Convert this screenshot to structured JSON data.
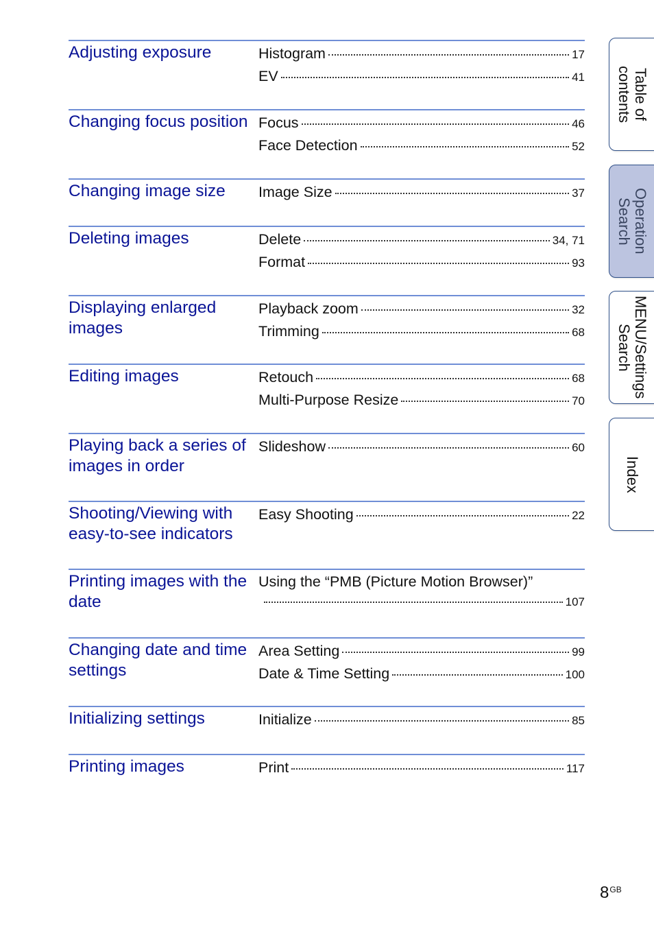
{
  "sections": [
    {
      "topic": "Adjusting exposure",
      "entries": [
        {
          "label": "Histogram",
          "page": "17"
        },
        {
          "label": "EV",
          "page": "41"
        }
      ]
    },
    {
      "topic": "Changing focus position",
      "entries": [
        {
          "label": "Focus",
          "page": "46"
        },
        {
          "label": "Face Detection",
          "page": "52"
        }
      ]
    },
    {
      "topic": "Changing image size",
      "entries": [
        {
          "label": "Image Size",
          "page": "37"
        }
      ]
    },
    {
      "topic": "Deleting images",
      "entries": [
        {
          "label": "Delete",
          "page": "34, 71"
        },
        {
          "label": "Format",
          "page": "93"
        }
      ]
    },
    {
      "topic": "Displaying enlarged images",
      "entries": [
        {
          "label": "Playback zoom",
          "page": "32"
        },
        {
          "label": "Trimming",
          "page": "68"
        }
      ]
    },
    {
      "topic": "Editing images",
      "entries": [
        {
          "label": "Retouch",
          "page": "68"
        },
        {
          "label": "Multi-Purpose Resize",
          "page": "70"
        }
      ]
    },
    {
      "topic": "Playing back a series of images in order",
      "entries": [
        {
          "label": "Slideshow",
          "page": "60"
        }
      ]
    },
    {
      "topic": "Shooting/Viewing with easy-to-see indicators",
      "entries": [
        {
          "label": "Easy Shooting",
          "page": "22"
        }
      ]
    },
    {
      "topic": "Printing images with the date",
      "entries": [
        {
          "label": "Using the “PMB (Picture Motion Browser)”",
          "page": "107"
        }
      ]
    },
    {
      "topic": "Changing date and time settings",
      "entries": [
        {
          "label": "Area Setting",
          "page": "99"
        },
        {
          "label": "Date & Time Setting",
          "page": "100"
        }
      ]
    },
    {
      "topic": "Initializing settings",
      "entries": [
        {
          "label": "Initialize",
          "page": "85"
        }
      ]
    },
    {
      "topic": "Printing images",
      "entries": [
        {
          "label": "Print",
          "page": "117"
        }
      ]
    }
  ],
  "tabs": [
    {
      "label": "Table of\ncontents",
      "active": false
    },
    {
      "label": "Operation\nSearch",
      "active": true
    },
    {
      "label": "MENU/Settings\nSearch",
      "active": false
    },
    {
      "label": "Index",
      "active": false
    }
  ],
  "footer": {
    "page_number": "8",
    "page_suffix": "GB"
  },
  "colors": {
    "topic": "#0a1496",
    "rule": "#6f8ed6",
    "active_tab": "#bcc4e0"
  }
}
